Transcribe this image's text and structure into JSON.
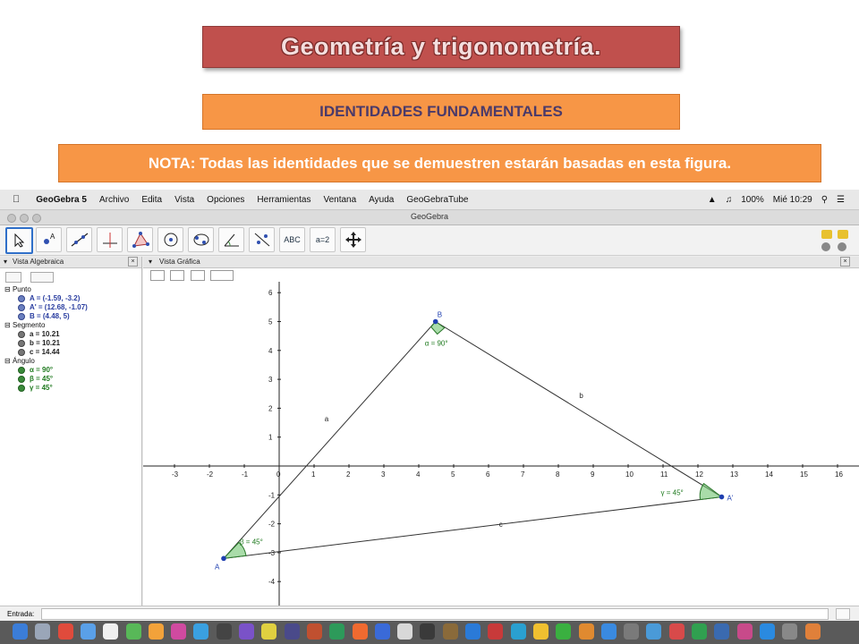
{
  "slide": {
    "title": "Geometría y trigonometría.",
    "subtitle": "IDENTIDADES FUNDAMENTALES",
    "note": "NOTA: Todas las identidades que se demuestren estarán basadas en esta figura."
  },
  "menubar": {
    "app": "GeoGebra 5",
    "items": [
      "Archivo",
      "Edita",
      "Vista",
      "Opciones",
      "Herramientas",
      "Ventana",
      "Ayuda",
      "GeoGebraTube"
    ],
    "battery": "100%",
    "clock": "Mié 10:29"
  },
  "window": {
    "title": "GeoGebra"
  },
  "toolbar": {
    "tools": [
      "move-tool",
      "point-tool",
      "line-tool",
      "perpendicular-tool",
      "polygon-tool",
      "circle-tool",
      "circle-through-points-tool",
      "angle-tool",
      "reflect-tool",
      "text-tool",
      "slider-tool",
      "move-view-tool"
    ],
    "text_tool_label": "ABC",
    "slider_tool_label": "a=2"
  },
  "algebra": {
    "header": "Vista Algebraica",
    "categories": [
      {
        "name": "Punto",
        "items": [
          "A = (-1.59, -3.2)",
          "A' = (12.68, -1.07)",
          "B = (4.48, 5)"
        ]
      },
      {
        "name": "Segmento",
        "items": [
          "a = 10.21",
          "b = 10.21",
          "c = 14.44"
        ]
      },
      {
        "name": "Ángulo",
        "items": [
          "α = 90°",
          "β = 45°",
          "γ = 45°"
        ]
      }
    ]
  },
  "graphics": {
    "header": "Vista Gráfica",
    "x_ticks": [
      "-3",
      "-2",
      "-1",
      "0",
      "1",
      "2",
      "3",
      "4",
      "5",
      "6",
      "7",
      "8",
      "9",
      "10",
      "11",
      "12",
      "13",
      "14",
      "15",
      "16"
    ],
    "y_ticks": [
      "6",
      "5",
      "4",
      "3",
      "2",
      "1",
      "-1",
      "-2",
      "-3",
      "-4"
    ],
    "points": [
      {
        "label": "A",
        "x": -1.59,
        "y": -3.2
      },
      {
        "label": "A'",
        "x": 12.68,
        "y": -1.07
      },
      {
        "label": "B",
        "x": 4.48,
        "y": 5
      }
    ],
    "segment_labels": [
      "a",
      "b",
      "c"
    ],
    "angle_labels": [
      "α = 90°",
      "β = 45°",
      "γ = 45°"
    ],
    "colors": {
      "segment": "#333333",
      "point": "#1f3fb0",
      "angle_fill": "#6fc56f",
      "angle_text": "#1f7a1f"
    }
  },
  "input_bar": {
    "label": "Entrada:"
  }
}
